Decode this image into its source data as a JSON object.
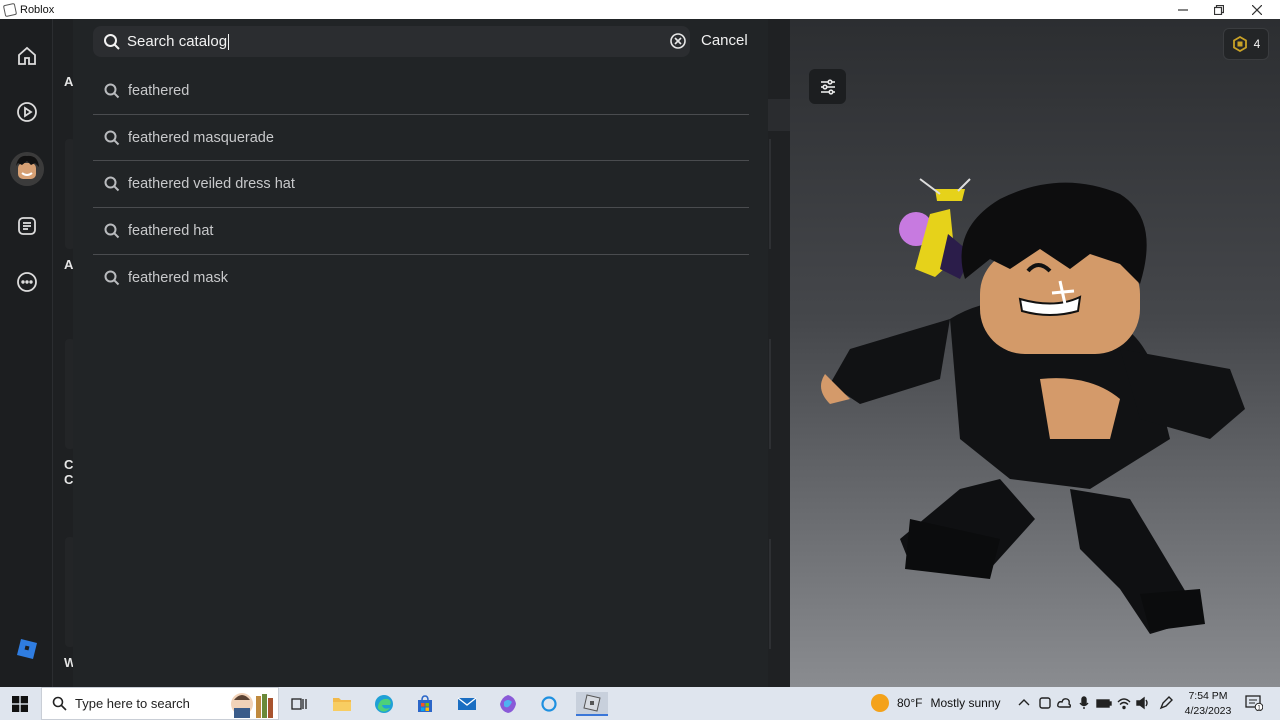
{
  "window": {
    "title": "Roblox"
  },
  "search": {
    "value": "Search catalog",
    "cancel_label": "Cancel"
  },
  "suggestions": [
    {
      "label": "feathered"
    },
    {
      "label": "feathered masquerade"
    },
    {
      "label": "feathered veiled dress hat"
    },
    {
      "label": "feathered hat"
    },
    {
      "label": "feathered mask"
    }
  ],
  "catalog_fragments": [
    "A",
    "A",
    "C",
    "C",
    "W"
  ],
  "robux": {
    "count": "4"
  },
  "taskbar": {
    "search_placeholder": "Type here to search",
    "weather": {
      "temp": "80°F",
      "condition": "Mostly sunny"
    },
    "time": "7:54 PM",
    "date": "4/23/2023",
    "notification_count": "1"
  },
  "colors": {
    "accent": "#3a76d8",
    "overlay_bg": "#212426",
    "nav_bg": "#1c1e20"
  },
  "icons": {
    "nav": [
      "home-icon",
      "play-icon",
      "avatar-icon",
      "chat-icon",
      "more-icon"
    ],
    "taskbar": [
      "task-view-icon",
      "file-explorer-icon",
      "edge-icon",
      "store-icon",
      "mail-icon",
      "copilot-icon",
      "cortana-icon",
      "roblox-icon"
    ]
  }
}
